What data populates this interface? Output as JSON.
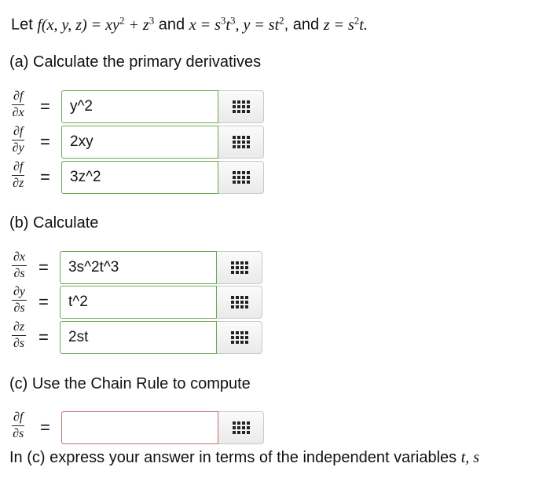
{
  "intro": {
    "let": "Let",
    "f_def": "f(x, y, z) = xy",
    "sq": "2",
    "plus_z": " + z",
    "cube": "3",
    "and1": "and",
    "x_def": "x = s",
    "x_exp1": "3",
    "t_part": "t",
    "x_exp2": "3",
    "y_def": ", y = st",
    "y_exp": "2",
    "and2": ", and",
    "z_def": "z = s",
    "z_exp": "2",
    "z_tail": "t."
  },
  "part_a": {
    "heading": "(a) Calculate the primary derivatives",
    "rows": [
      {
        "num": "∂f",
        "den": "∂x",
        "value": "y^2"
      },
      {
        "num": "∂f",
        "den": "∂y",
        "value": "2xy"
      },
      {
        "num": "∂f",
        "den": "∂z",
        "value": "3z^2"
      }
    ]
  },
  "part_b": {
    "heading": "(b) Calculate",
    "rows": [
      {
        "num": "∂x",
        "den": "∂s",
        "value": "3s^2t^3"
      },
      {
        "num": "∂y",
        "den": "∂s",
        "value": "t^2"
      },
      {
        "num": "∂z",
        "den": "∂s",
        "value": "2st"
      }
    ]
  },
  "part_c": {
    "heading": "(c) Use the Chain Rule to compute",
    "row": {
      "num": "∂f",
      "den": "∂s",
      "value": ""
    },
    "note": "In (c) express your answer in terms of the independent variables",
    "note_vars": "t, s"
  },
  "equals": "=",
  "palette_icon": "grid-icon"
}
